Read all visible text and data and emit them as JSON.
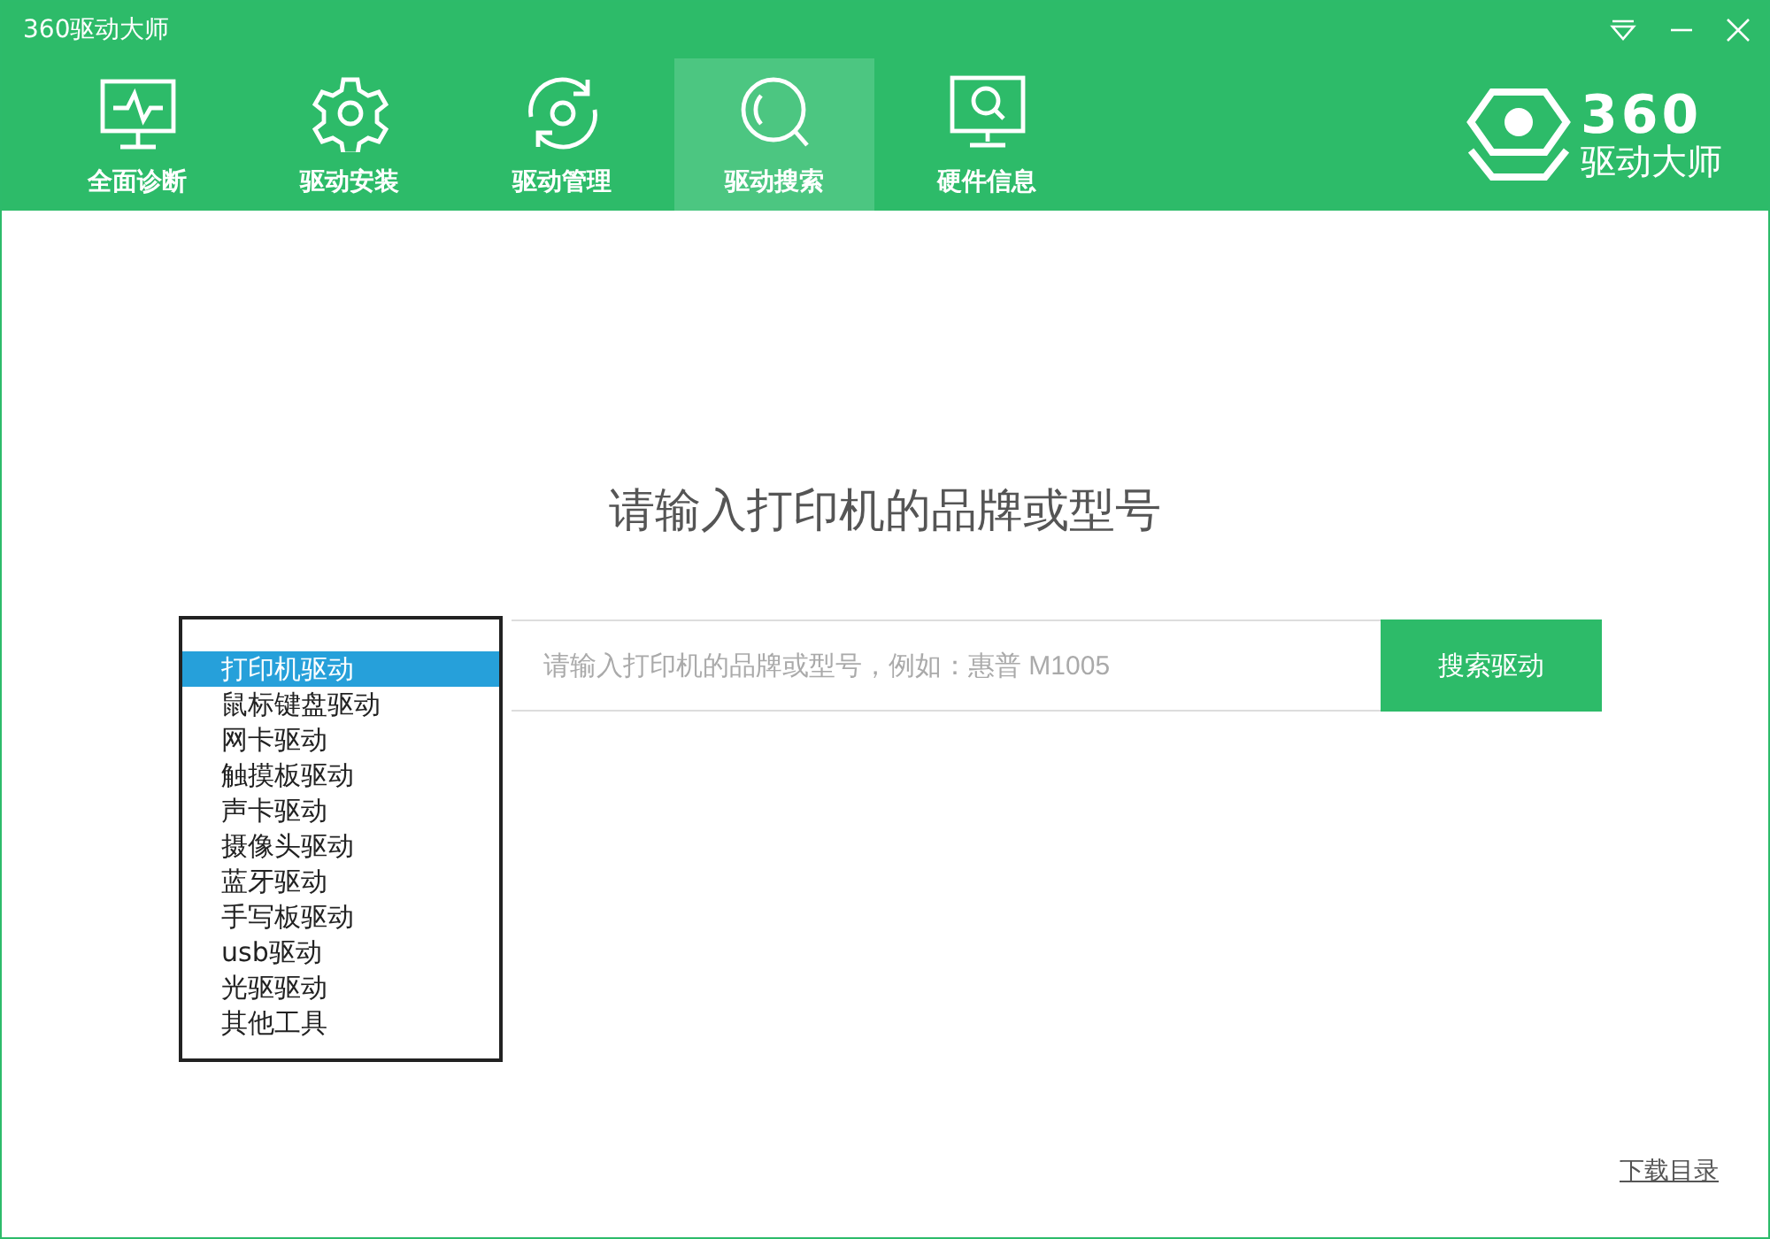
{
  "window": {
    "title": "360驱动大师"
  },
  "tabs": [
    {
      "label": "全面诊断",
      "kind": "monitor",
      "selected": false
    },
    {
      "label": "驱动安装",
      "kind": "gear",
      "selected": false
    },
    {
      "label": "驱动管理",
      "kind": "refresh",
      "selected": false
    },
    {
      "label": "驱动搜索",
      "kind": "search",
      "selected": true
    },
    {
      "label": "硬件信息",
      "kind": "hardware",
      "selected": false
    }
  ],
  "logo": {
    "number": "360",
    "name": "驱动大师"
  },
  "heading": "请输入打印机的品牌或型号",
  "search": {
    "placeholder": "请输入打印机的品牌或型号，例如：惠普 M1005",
    "button": "搜索驱动",
    "category_list": [
      {
        "label": "打印机驱动",
        "selected": true
      },
      {
        "label": "鼠标键盘驱动",
        "selected": false
      },
      {
        "label": "网卡驱动",
        "selected": false
      },
      {
        "label": "触摸板驱动",
        "selected": false
      },
      {
        "label": "声卡驱动",
        "selected": false
      },
      {
        "label": "摄像头驱动",
        "selected": false
      },
      {
        "label": "蓝牙驱动",
        "selected": false
      },
      {
        "label": "手写板驱动",
        "selected": false
      },
      {
        "label": "usb驱动",
        "selected": false
      },
      {
        "label": "光驱驱动",
        "selected": false
      },
      {
        "label": "其他工具",
        "selected": false
      }
    ]
  },
  "footer_link": "下载目录"
}
